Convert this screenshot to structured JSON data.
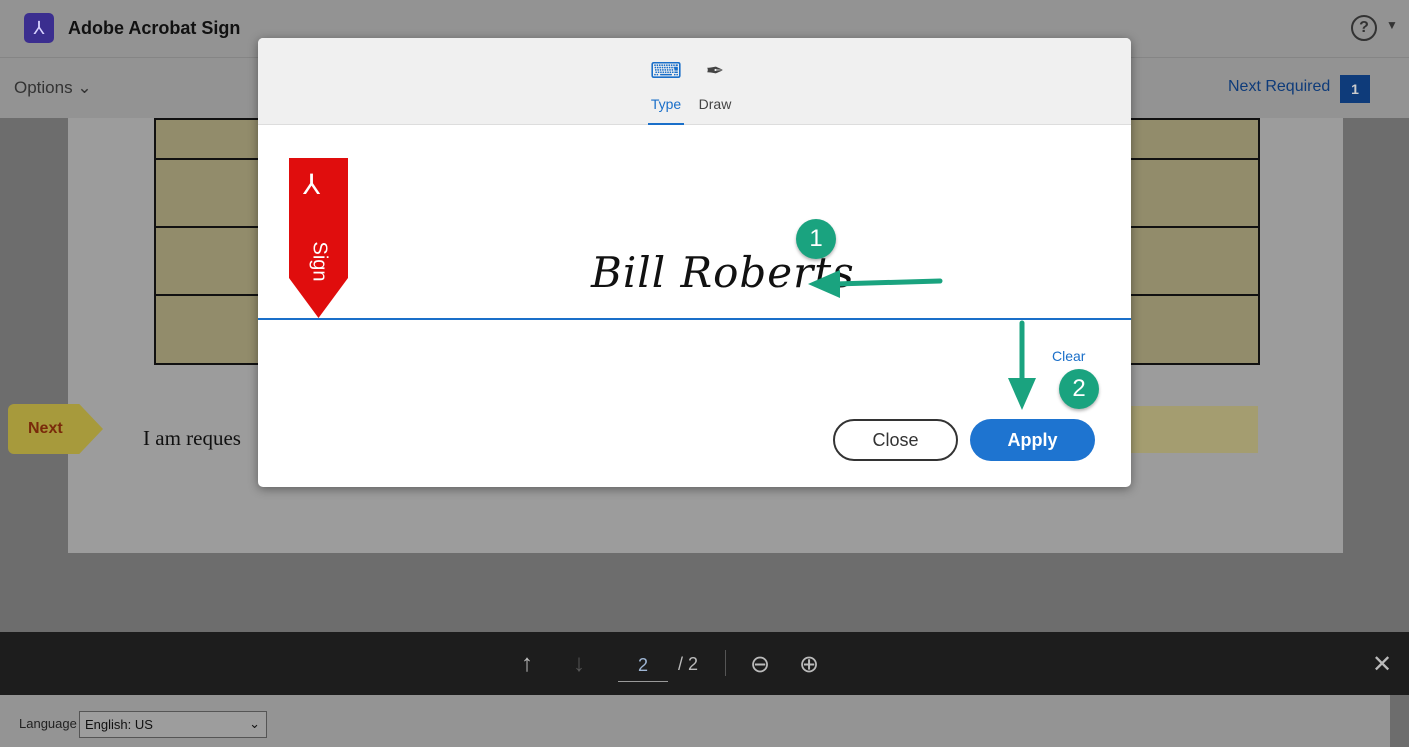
{
  "app": {
    "title": "Adobe Acrobat Sign",
    "help": "?"
  },
  "toolbar": {
    "options": "Options",
    "next_required": "Next Required",
    "next_required_count": "1"
  },
  "document": {
    "next_tag": "Next",
    "text": "I am reques"
  },
  "modal": {
    "tabs": [
      {
        "label": "Type",
        "icon": "keyboard-icon",
        "active": true
      },
      {
        "label": "Draw",
        "icon": "pen-icon"
      }
    ],
    "flag_label": "Sign",
    "signature": "Bill Roberts",
    "clear": "Clear",
    "close": "Close",
    "apply": "Apply"
  },
  "annotations": {
    "badge1": "1",
    "badge2": "2",
    "arrow_color": "#1aa37f"
  },
  "nav": {
    "page": "2",
    "total": "/ 2"
  },
  "language": {
    "label": "Language",
    "selected": "English: US"
  }
}
